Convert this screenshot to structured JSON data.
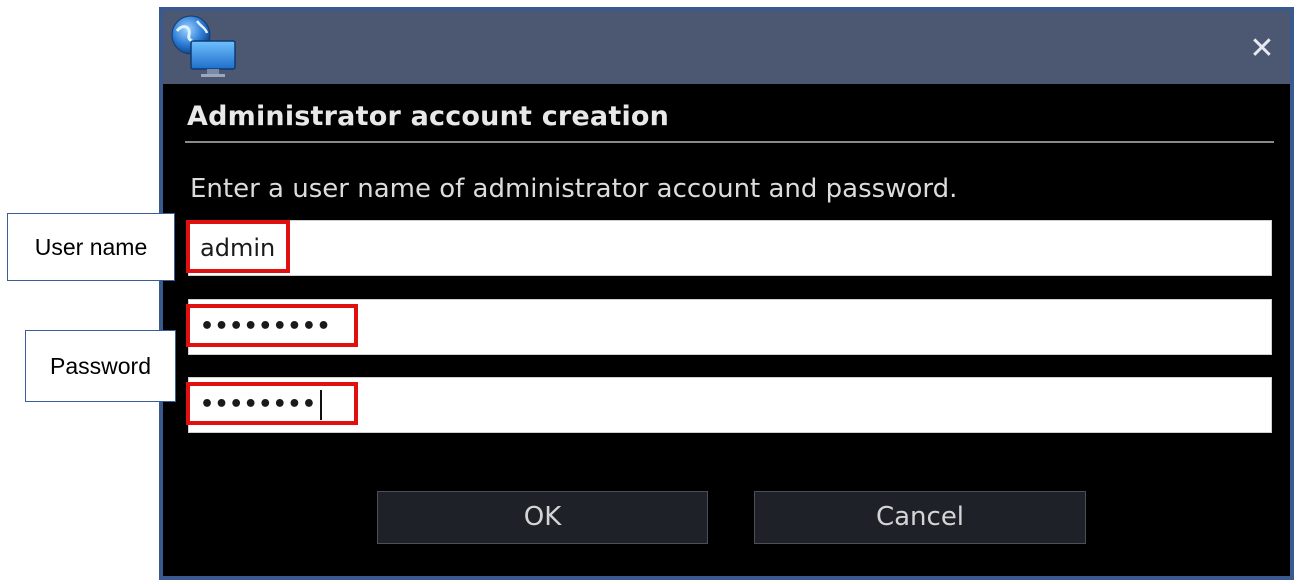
{
  "window": {
    "close_glyph": "✕",
    "app_icon": "globe-monitor-icon"
  },
  "dialog": {
    "heading": "Administrator account creation",
    "instruction": "Enter a user name of administrator account and password.",
    "fields": {
      "user_name": "admin",
      "password": "•••••••••",
      "password_confirm": "••••••••"
    },
    "buttons": {
      "ok": "OK",
      "cancel": "Cancel"
    }
  },
  "annotations": {
    "user_name_label": "User name",
    "password_label": "Password",
    "highlight_color": "#e01010"
  },
  "colors": {
    "titlebar": "#4c5871",
    "window_border": "#39598f",
    "dialog_background": "#000000"
  }
}
